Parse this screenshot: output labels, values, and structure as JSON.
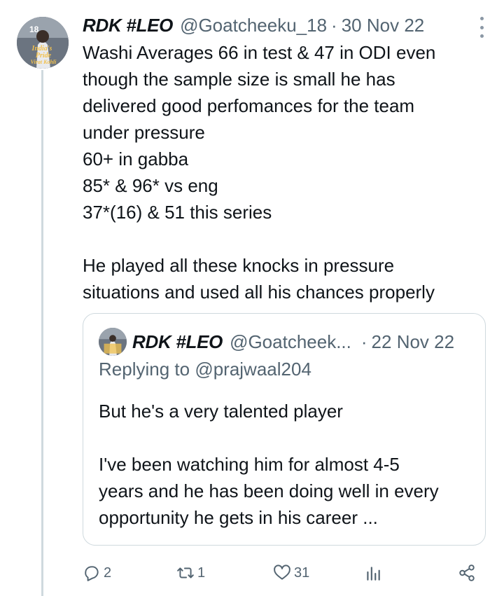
{
  "tweet": {
    "author_name": "RDK #LEO",
    "handle": "@Goatcheeku_18",
    "separator": "·",
    "date": "30 Nov 22",
    "avatar_text": [
      "18",
      "India's",
      "Pride",
      "Virat Kohli"
    ],
    "text_lines": [
      "Washi Averages 66 in test & 47 in ODI even",
      "though the sample size is small he has",
      "delivered good perfomances for the team",
      "under pressure",
      "60+ in gabba",
      "85* & 96* vs eng",
      "37*(16) & 51 this series",
      "",
      "He played all these knocks in pressure",
      "situations and used all his chances properly"
    ]
  },
  "quoted_tweet": {
    "author_name": "RDK #LEO",
    "handle": "@Goatcheek...",
    "separator": "·",
    "date": "22 Nov 22",
    "replying_prefix": "Replying to",
    "replying_to": "@prajwaal204",
    "text_lines": [
      "But he's a very talented player",
      "",
      "I've been watching him for almost 4-5",
      "years and he has been doing well in every",
      "opportunity he gets in his career ..."
    ]
  },
  "actions": {
    "replies": "2",
    "retweets": "1",
    "likes": "31"
  },
  "icons": {
    "reply": "reply-icon",
    "retweet": "retweet-icon",
    "like": "heart-icon",
    "views": "views-icon",
    "share": "share-icon",
    "more": "more-options-icon"
  },
  "colors": {
    "text": "#0f1419",
    "secondary": "#536471",
    "border": "#cfd9de"
  }
}
